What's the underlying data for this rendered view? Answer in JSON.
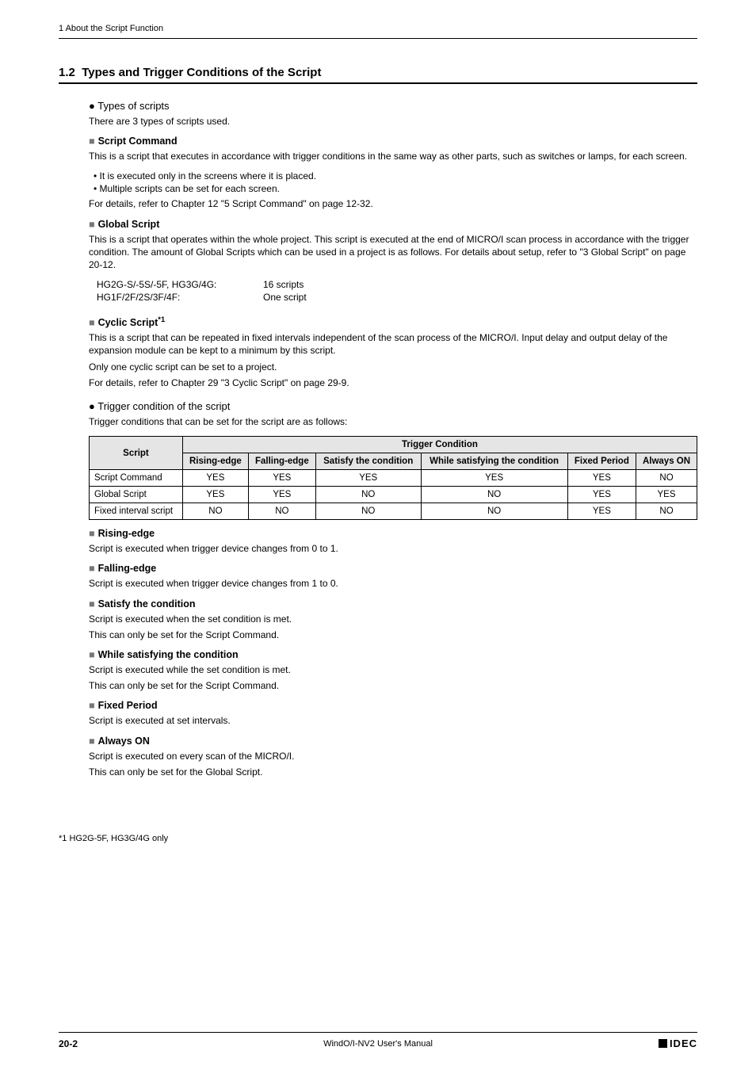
{
  "runningHeader": "1 About the Script Function",
  "section": {
    "number": "1.2",
    "title": "Types and Trigger Conditions of the Script"
  },
  "typesHeading": "Types of scripts",
  "typesIntro": "There are 3 types of scripts used.",
  "scriptCommand": {
    "heading": "Script Command",
    "para1": "This is a script that executes in accordance with trigger conditions in the same way as other parts, such as switches or lamps, for each screen.",
    "bullet1": "It is executed only in the screens where it is placed.",
    "bullet2": "Multiple scripts can be set for each screen.",
    "para2": "For details, refer to Chapter 12 \"5 Script Command\" on page 12-32."
  },
  "globalScript": {
    "heading": "Global Script",
    "para1": "This is a script that operates within the whole project. This script is executed at the end of MICRO/I scan process in accordance with the trigger condition. The amount of Global Scripts which can be used in a project is as follows. For details about setup, refer to \"3 Global Script\" on page 20-12.",
    "rows": [
      {
        "k": "HG2G-S/-5S/-5F, HG3G/4G:",
        "v": "16 scripts"
      },
      {
        "k": "HG1F/2F/2S/3F/4F:",
        "v": "One script"
      }
    ]
  },
  "cyclicScript": {
    "heading": "Cyclic Script",
    "sup": "*1",
    "para1": "This is a script that can be repeated in fixed intervals independent of the scan process of the MICRO/I. Input delay and output delay of the expansion module can be kept to a minimum by this script.",
    "para2": "Only one cyclic script can be set to a project.",
    "para3": "For details, refer to Chapter 29 \"3 Cyclic Script\" on page 29-9."
  },
  "triggerHeading": "Trigger condition of the script",
  "triggerIntro": "Trigger conditions that can be set for the script are as follows:",
  "table": {
    "colScript": "Script",
    "groupHeader": "Trigger Condition",
    "cols": [
      "Rising-edge",
      "Falling-edge",
      "Satisfy the condition",
      "While satisfying the condition",
      "Fixed Period",
      "Always ON"
    ],
    "rows": [
      {
        "name": "Script Command",
        "vals": [
          "YES",
          "YES",
          "YES",
          "YES",
          "YES",
          "NO"
        ]
      },
      {
        "name": "Global Script",
        "vals": [
          "YES",
          "YES",
          "NO",
          "NO",
          "YES",
          "YES"
        ]
      },
      {
        "name": "Fixed interval script",
        "vals": [
          "NO",
          "NO",
          "NO",
          "NO",
          "YES",
          "NO"
        ]
      }
    ]
  },
  "definitions": [
    {
      "h": "Rising-edge",
      "lines": [
        "Script is executed when trigger device changes from 0 to 1."
      ]
    },
    {
      "h": "Falling-edge",
      "lines": [
        "Script is executed when trigger device changes from 1 to 0."
      ]
    },
    {
      "h": "Satisfy the condition",
      "lines": [
        "Script is executed when the set condition is met.",
        "This can only be set for the Script Command."
      ]
    },
    {
      "h": "While satisfying the condition",
      "lines": [
        "Script is executed while the set condition is met.",
        "This can only be set for the Script Command."
      ]
    },
    {
      "h": "Fixed Period",
      "lines": [
        "Script is executed at set intervals."
      ]
    },
    {
      "h": "Always ON",
      "lines": [
        "Script is executed on every scan of the MICRO/I.",
        "This can only be set for the Global Script."
      ]
    }
  ],
  "footnote": "*1  HG2G-5F, HG3G/4G only",
  "footer": {
    "page": "20-2",
    "center": "WindO/I-NV2 User's Manual",
    "logo": "IDEC"
  }
}
